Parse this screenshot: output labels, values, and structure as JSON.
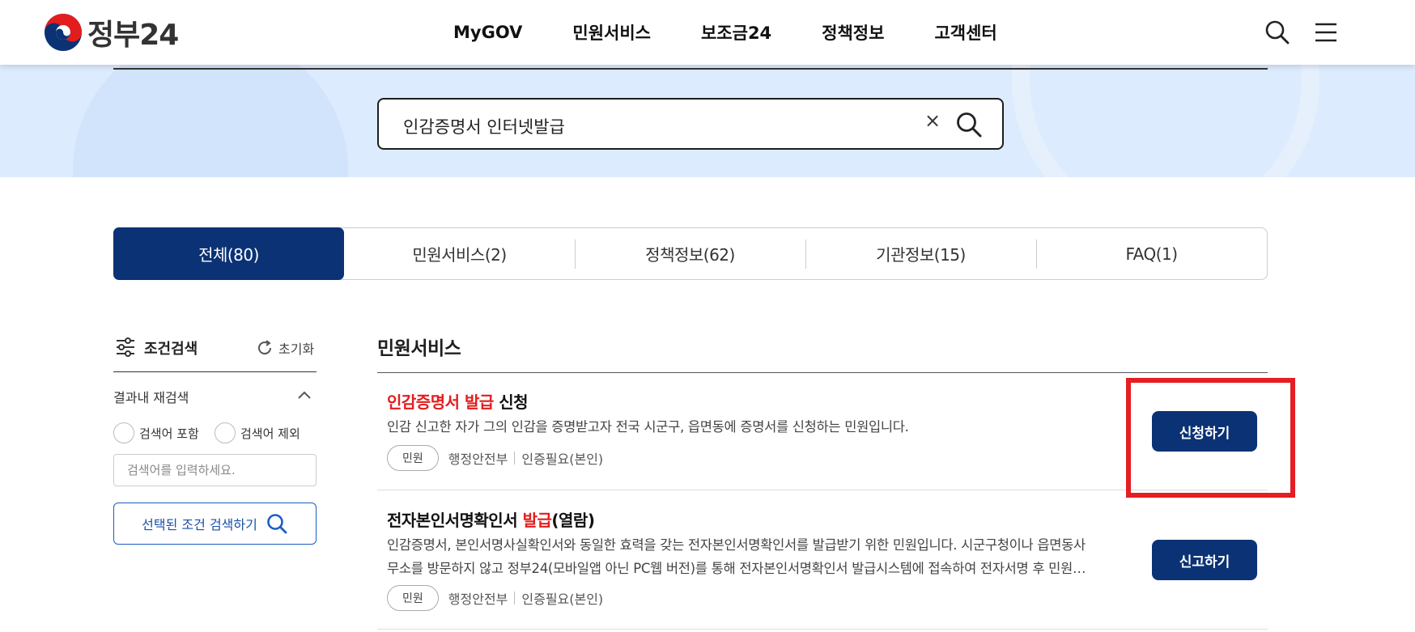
{
  "header": {
    "logo_text": "정부24",
    "nav": [
      "MyGOV",
      "민원서비스",
      "보조금24",
      "정책정보",
      "고객센터"
    ]
  },
  "search": {
    "query": "인감증명서 인터넷발급",
    "clear_glyph": "×"
  },
  "tabs": [
    {
      "label": "전체(80)",
      "active": true
    },
    {
      "label": "민원서비스(2)",
      "active": false
    },
    {
      "label": "정책정보(62)",
      "active": false
    },
    {
      "label": "기관정보(15)",
      "active": false
    },
    {
      "label": "FAQ(1)",
      "active": false
    }
  ],
  "filter": {
    "title": "조건검색",
    "reset_label": "초기화",
    "refine_title": "결과내 재검색",
    "include_label": "검색어 포함",
    "exclude_label": "검색어 제외",
    "input_placeholder": "검색어를 입력하세요.",
    "apply_label": "선택된 조건 검색하기"
  },
  "results": {
    "section_title": "민원서비스",
    "items": [
      {
        "title_hl1": "인감증명서",
        "title_mid1": " ",
        "title_hl2": "발급",
        "title_rest": " 신청",
        "desc": "인감 신고한 자가 그의 인감을 증명받고자 전국 시군구, 읍면동에 증명서를 신청하는 민원입니다.",
        "badge": "민원",
        "agency": "행정안전부",
        "auth": "인증필요(본인)",
        "button": "신청하기"
      },
      {
        "title_pre": "전자본인서명확인서 ",
        "title_hl": "발급",
        "title_rest": "(열람)",
        "desc_line1": "인감증명서, 본인서명사실확인서와 동일한 효력을 갖는 전자본인서명확인서를 발급받기 위한 민원입니다. 시군구청이나 읍면동사",
        "desc_line2": "무소를 방문하지 않고 정부24(모바일앱 아닌 PC웹 버전)를 통해 전자본인서명확인서 발급시스템에 접속하여 전자서명 후 민원…",
        "badge": "민원",
        "agency": "행정안전부",
        "auth": "인증필요(본인)",
        "button": "신고하기"
      }
    ]
  },
  "colors": {
    "brand_navy": "#0b3275",
    "highlight_red": "#e31d1d",
    "annotation_red": "#e41e23",
    "banner_bg": "#dcebfd"
  }
}
